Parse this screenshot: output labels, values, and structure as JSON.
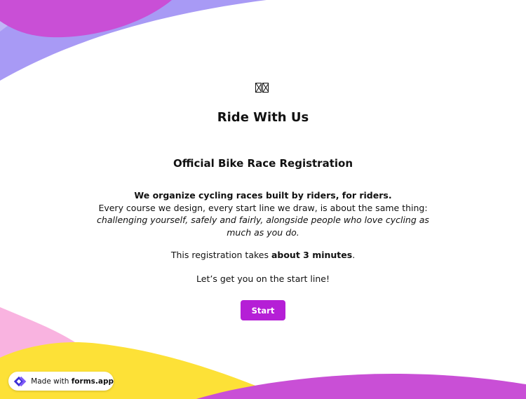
{
  "hero": {
    "icon": "missing-glyph-icon",
    "title": "Ride With Us",
    "subtitle": "Official Bike Race Registration"
  },
  "description": {
    "headline": "We organize cycling races built by riders, for riders.",
    "line2": "Every course we design, every start line we draw, is about the same thing:",
    "line3": "challenging yourself, safely and fairly, alongside people who love cycling as much as you do."
  },
  "duration": {
    "prefix": "This registration takes ",
    "emphasis": "about 3 minutes",
    "suffix": "."
  },
  "cta_text": "Let’s get you on the start line!",
  "start_button": "Start",
  "badge": {
    "prefix": "Made with ",
    "brand": "forms.app",
    "logo_icon": "forms-app-logo-icon"
  },
  "colors": {
    "accent": "#b51fd6",
    "blob_magenta": "#c94fd6",
    "blob_lavender": "#a89af5",
    "blob_yellow": "#fde137",
    "blob_pink": "#f9b3e0"
  }
}
